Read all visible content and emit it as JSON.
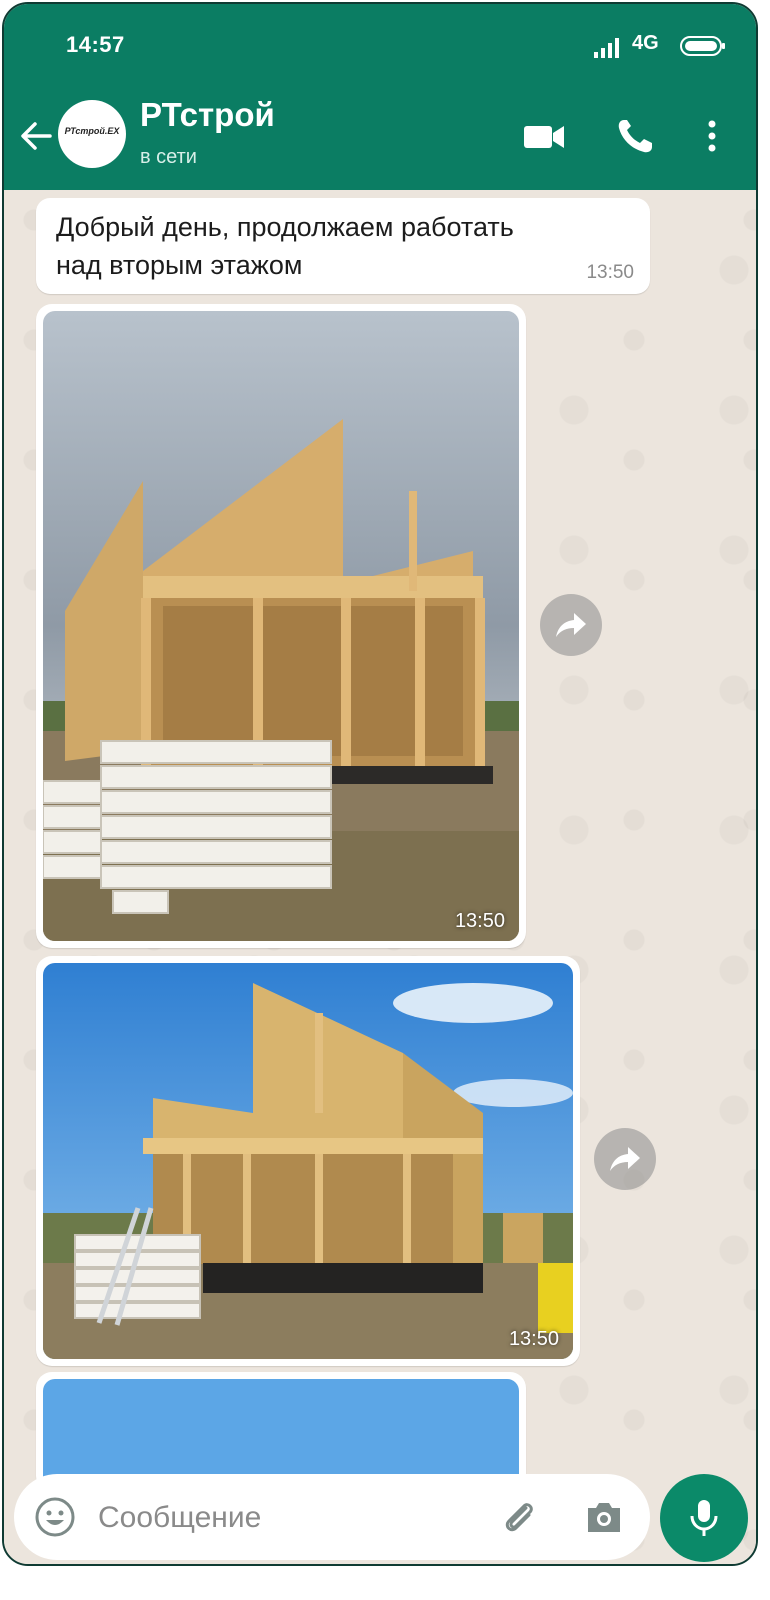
{
  "status_bar": {
    "time": "14:57",
    "network": "4G"
  },
  "chat_header": {
    "contact_name": "РТстрой",
    "contact_status": "в сети",
    "avatar_text": "РТстрой.ЕХ"
  },
  "messages": [
    {
      "type": "text",
      "text_line1": "Добрый день, продолжаем работать",
      "text_line2": "над вторым этажом",
      "time": "13:50"
    },
    {
      "type": "photo",
      "time": "13:50"
    },
    {
      "type": "photo",
      "time": "13:50"
    },
    {
      "type": "photo",
      "time": ""
    }
  ],
  "composer": {
    "placeholder": "Сообщение"
  },
  "colors": {
    "header": "#0b7d63",
    "mic_button": "#0b8a69",
    "chat_background": "#ece5dd"
  },
  "icons": [
    "back-arrow-icon",
    "video-call-icon",
    "phone-icon",
    "more-vert-icon",
    "forward-icon",
    "emoji-icon",
    "attach-icon",
    "camera-icon",
    "mic-icon"
  ]
}
